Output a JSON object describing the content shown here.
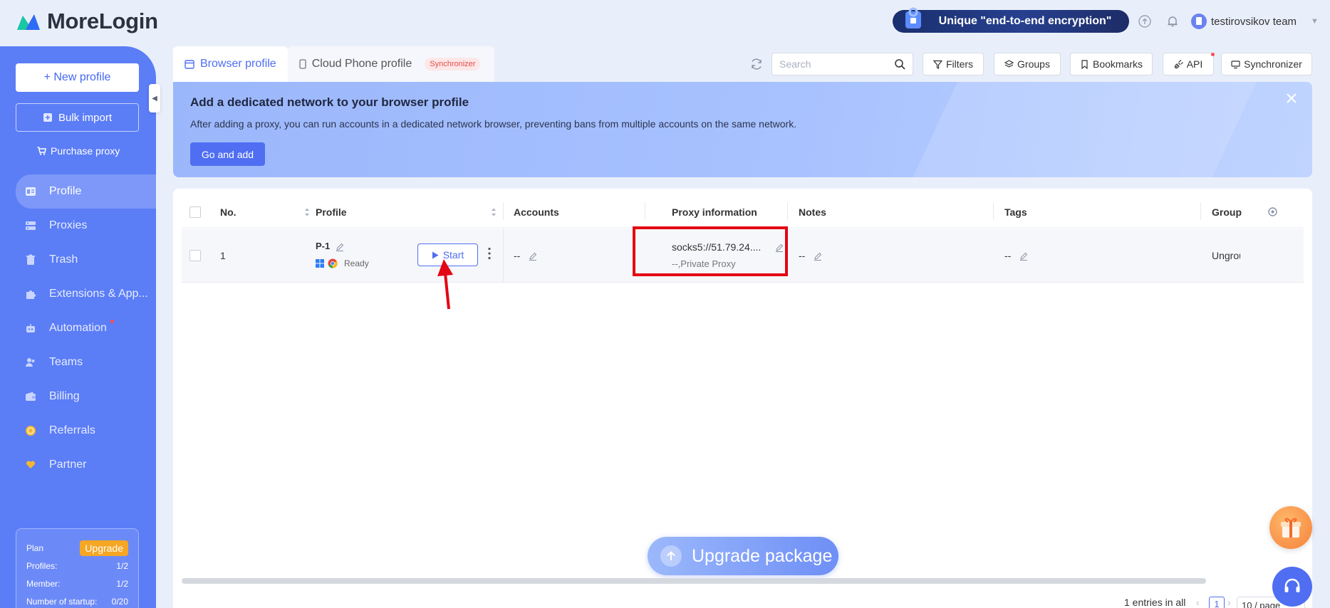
{
  "app": {
    "name": "MoreLogin",
    "promo": "Unique \"end-to-end encryption\"",
    "team": "testirovsikov team"
  },
  "sidebar": {
    "new_profile": "+ New profile",
    "bulk_import": "Bulk import",
    "purchase_proxy": "Purchase proxy",
    "items": [
      {
        "label": "Profile",
        "icon": "profile-icon",
        "active": true
      },
      {
        "label": "Proxies",
        "icon": "proxies-icon"
      },
      {
        "label": "Trash",
        "icon": "trash-icon"
      },
      {
        "label": "Extensions & App...",
        "icon": "puzzle-icon"
      },
      {
        "label": "Automation",
        "icon": "robot-icon",
        "dot": true
      },
      {
        "label": "Teams",
        "icon": "team-icon"
      },
      {
        "label": "Billing",
        "icon": "wallet-icon"
      },
      {
        "label": "Referrals",
        "icon": "coin-icon"
      },
      {
        "label": "Partner",
        "icon": "heart-hand-icon"
      }
    ],
    "plan": {
      "label": "Plan",
      "upgrade": "Upgrade",
      "rows": [
        {
          "label": "Profiles:",
          "value": "1/2"
        },
        {
          "label": "Member:",
          "value": "1/2"
        },
        {
          "label": "Number of startup:",
          "value": "0/20"
        }
      ]
    }
  },
  "tabs": {
    "browser": "Browser profile",
    "cloud": "Cloud Phone profile",
    "sync_tag": "Synchronizer"
  },
  "toolbar": {
    "search_placeholder": "Search",
    "filters": "Filters",
    "groups": "Groups",
    "bookmarks": "Bookmarks",
    "api": "API",
    "synchronizer": "Synchronizer"
  },
  "banner": {
    "title": "Add a dedicated network to your browser profile",
    "desc": "After adding a proxy, you can run accounts in a dedicated network browser, preventing bans from multiple accounts on the same network.",
    "button": "Go and add"
  },
  "table": {
    "headers": {
      "no": "No.",
      "profile": "Profile",
      "accounts": "Accounts",
      "proxy": "Proxy information",
      "notes": "Notes",
      "tags": "Tags",
      "group": "Group"
    },
    "rows": [
      {
        "no": "1",
        "name": "P-1",
        "status": "Ready",
        "start": "Start",
        "accounts": "--",
        "proxy": "socks5://51.79.24....",
        "proxy_type": "--,Private Proxy",
        "notes": "--",
        "tags": "--",
        "group": "Ungrou"
      }
    ]
  },
  "footer": {
    "upgrade": "Upgrade package",
    "entries": "1 entries in all",
    "page": "1",
    "page_size": "10 / page"
  }
}
